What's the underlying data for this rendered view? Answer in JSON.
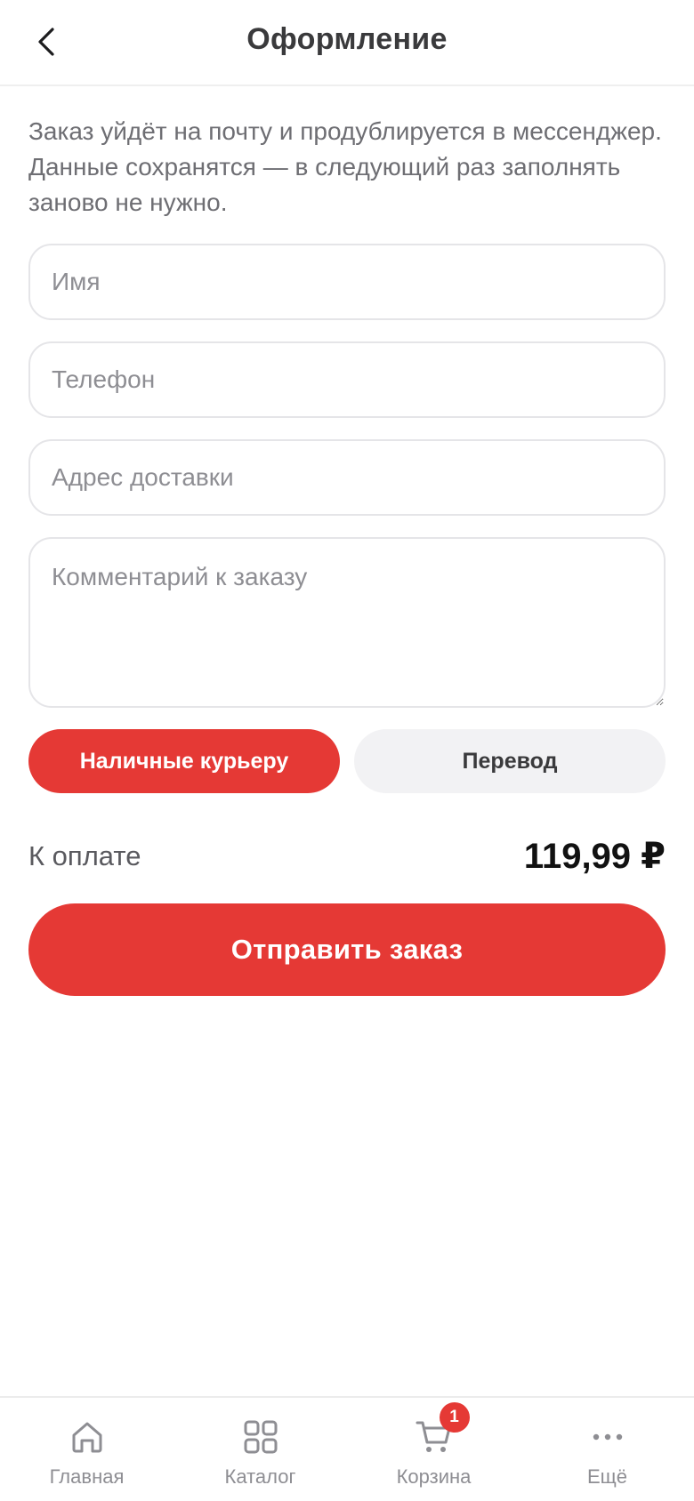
{
  "header": {
    "title": "Оформление",
    "back_icon": "chevron-left-icon"
  },
  "intro_text": "Заказ уйдёт на почту и продублируется в мессенджер. Данные сохранятся — в следующий раз заполнять заново не нужно.",
  "form": {
    "name_placeholder": "Имя",
    "name_value": "",
    "phone_placeholder": "Телефон",
    "phone_value": "",
    "address_placeholder": "Адрес доставки",
    "address_value": "",
    "comment_placeholder": "Комментарий к заказу",
    "comment_value": ""
  },
  "payment": {
    "options": [
      {
        "label": "Наличные курьеру",
        "selected": true
      },
      {
        "label": "Перевод",
        "selected": false
      }
    ]
  },
  "total": {
    "label": "К оплате",
    "value": "119,99 ₽"
  },
  "submit_label": "Отправить заказ",
  "tabbar": {
    "items": [
      {
        "label": "Главная",
        "icon": "home-icon"
      },
      {
        "label": "Каталог",
        "icon": "grid-icon"
      },
      {
        "label": "Корзина",
        "icon": "cart-icon",
        "badge": "1"
      },
      {
        "label": "Ещё",
        "icon": "more-icon"
      }
    ]
  },
  "colors": {
    "accent": "#e53935",
    "inactive_pill": "#f2f2f4",
    "muted_text": "#8e8e93"
  }
}
